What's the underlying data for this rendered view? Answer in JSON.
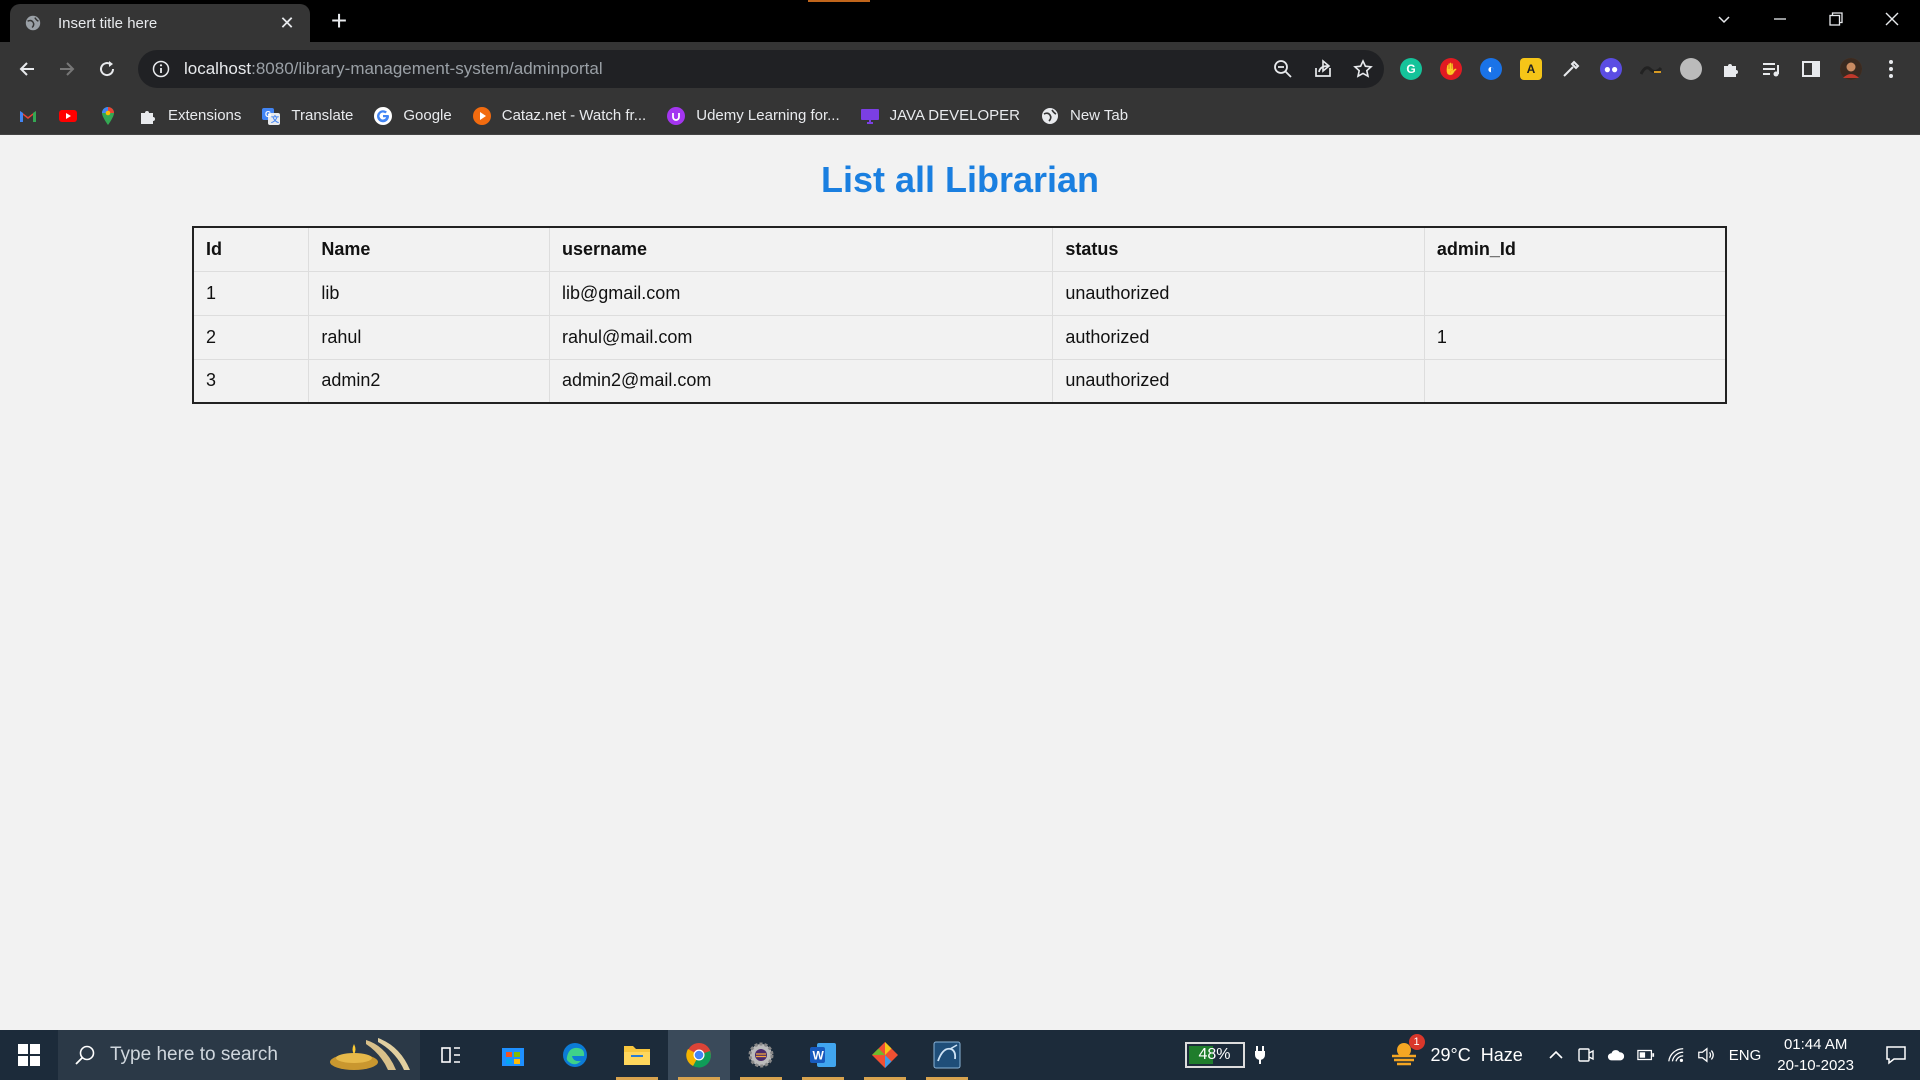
{
  "browser": {
    "tab_title": "Insert title here",
    "url_host": "localhost",
    "url_rest": ":8080/library-management-system/adminportal",
    "bookmarks": [
      {
        "label": "",
        "icon": "gmail-icon",
        "color": "#ea4335"
      },
      {
        "label": "",
        "icon": "youtube-icon",
        "color": "#ff0000"
      },
      {
        "label": "",
        "icon": "maps-icon",
        "color": "#34a853"
      },
      {
        "label": "Extensions",
        "icon": "puzzle-icon",
        "color": "#353535"
      },
      {
        "label": "Translate",
        "icon": "translate-icon",
        "color": "#4285f4"
      },
      {
        "label": "Google",
        "icon": "google-icon",
        "color": "#ffffff"
      },
      {
        "label": "Cataz.net - Watch fr...",
        "icon": "play-icon",
        "color": "#f26b0f"
      },
      {
        "label": "Udemy Learning for...",
        "icon": "udemy-icon",
        "color": "#a435f0"
      },
      {
        "label": "JAVA DEVELOPER",
        "icon": "monitor-icon",
        "color": "#7b3fe4"
      },
      {
        "label": "New Tab",
        "icon": "globe-icon",
        "color": "#353535"
      }
    ]
  },
  "page": {
    "heading": "List all Librarian",
    "table": {
      "columns": [
        "Id",
        "Name",
        "username",
        "status",
        "admin_Id"
      ],
      "rows": [
        [
          "1",
          "lib",
          "lib@gmail.com",
          "unauthorized",
          ""
        ],
        [
          "2",
          "rahul",
          "rahul@mail.com",
          "authorized",
          "1"
        ],
        [
          "3",
          "admin2",
          "admin2@mail.com",
          "unauthorized",
          ""
        ]
      ]
    }
  },
  "taskbar": {
    "search_placeholder": "Type here to search",
    "battery_percent": "48%",
    "battery_level": 0.48,
    "weather": "29°C  Haze",
    "weather_badge": "1",
    "language": "ENG",
    "time": "01:44 AM",
    "date": "20-10-2023"
  },
  "colors": {
    "heading": "#1a7fe0",
    "chrome_dark": "#353535",
    "taskbar": "#1c2b3a"
  }
}
